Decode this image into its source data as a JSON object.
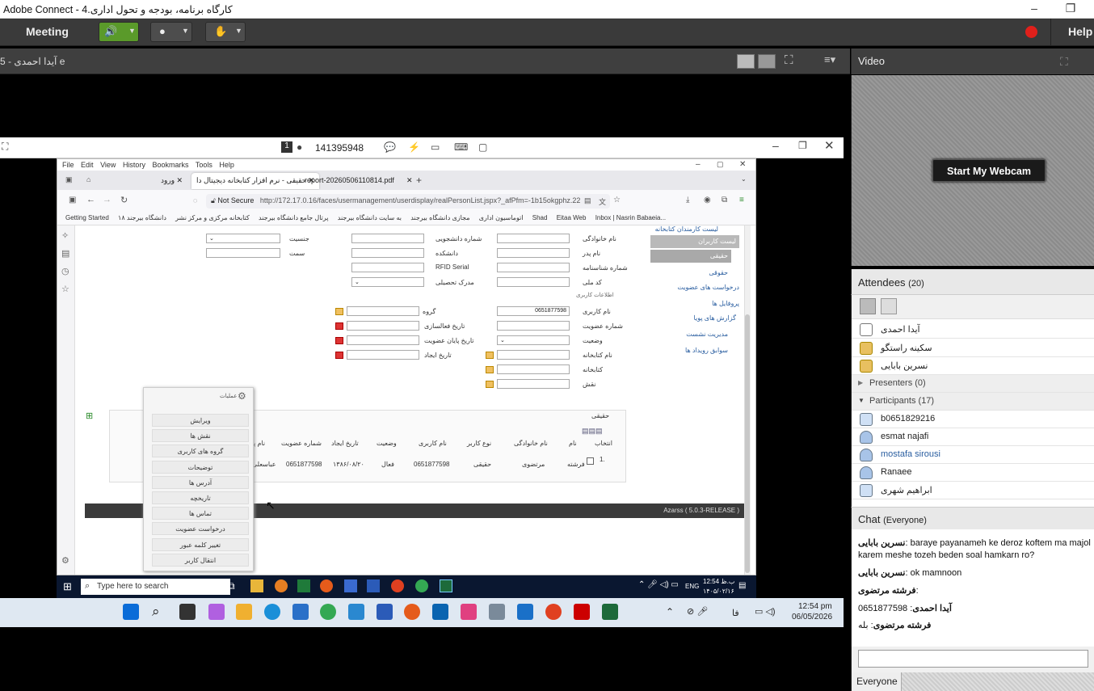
{
  "window": {
    "title": "Adobe Connect - کارگاه برنامه، بودجه و تحول اداری.4",
    "minimize": "–",
    "restore": "❐"
  },
  "menubar": {
    "meeting": "Meeting",
    "help": "Help"
  },
  "share": {
    "presenter_label": "آیدا احمدی - 5 e"
  },
  "rvw": {
    "page_num": "1",
    "meeting_id": "141395948"
  },
  "browser": {
    "menu": [
      "File",
      "Edit",
      "View",
      "History",
      "Bookmarks",
      "Tools",
      "Help"
    ],
    "tabs": [
      "ورود",
      "حقیقی - نرم افزار کتابخانه دیجیتال دا",
      "report-20260506110814.pdf"
    ],
    "new_tab": "+",
    "not_secure": "Not Secure",
    "url": "http://172.17.0.16/faces/usermanagement/userdisplay/realPersonList.jspx?_afPfm=-1b15okgphz.22",
    "bookmarks": [
      "Getting Started",
      "اتوماسیون اداری",
      "مجازی دانشگاه بیرجند",
      "به سایت دانشگاه بیرجند",
      "پرتال جامع دانشگاه بیرجند",
      "کتابخانه مرکزی و مرکز نشر",
      "دانشگاه بیرجند ۱۸",
      "Shad",
      "Eitaa Web",
      "Inbox | Nasrin Babaeia..."
    ]
  },
  "form": {
    "labels": {
      "family": "نام خانوادگی",
      "student_no": "شماره دانشجویی",
      "gender": "جنسیت",
      "father": "نام پدر",
      "faculty": "دانشکده",
      "post": "سمت",
      "id_no": "شماره شناسنامه",
      "rfid": "RFID Serial",
      "national": "کد ملی",
      "degree": "مدرک تحصیلی",
      "user_info": "اطلاعات کاربری",
      "username": "نام کاربری",
      "group": "گروه",
      "member_no": "شماره عضویت",
      "activation": "تاریخ فعالسازی",
      "status": "وضعیت",
      "end_date": "تاریخ پایان عضویت",
      "library": "نام کتابخانه",
      "created": "تاریخ ایجاد",
      "library2": "کتابخانه",
      "role": "نقش"
    },
    "username_value": "0651877598"
  },
  "nav": {
    "items": [
      "لیست کاربران",
      "حقیقی",
      "حقوقی",
      "درخواست های عضویت",
      "پروفایل ها",
      "گزارش های پویا",
      "مدیریت نشست",
      "سوابق رویداد ها"
    ],
    "top": "لیست کارمندان کتابخانه"
  },
  "results": {
    "title": "حقیقی",
    "headers": [
      "انتخاب",
      "نام",
      "نام خانوادگی",
      "نوع کاربر",
      "نام کاربری",
      "وضعیت",
      "تاریخ ایجاد",
      "شماره عضویت",
      "نام پدر",
      "ش"
    ],
    "row": {
      "index": "1.",
      "name": "فرشته",
      "family": "مرتضوی",
      "type": "حقیقی",
      "username": "0651877598",
      "status": "فعال",
      "created": "۱۳۸۶/۰۸/۲۰",
      "member_no": "0651877598",
      "father": "عباسعلی"
    }
  },
  "context_menu": {
    "title": "عملیات",
    "items": [
      "ویرایش",
      "نقش ها",
      "گروه های کاربری",
      "توضیحات",
      "آدرس ها",
      "تاریخچه",
      "تماس ها",
      "درخواست عضویت",
      "تغییر کلمه عبور",
      "انتقال کاربر"
    ]
  },
  "footer": {
    "text": "Azarss ( 5.0.3-RELEASE )"
  },
  "inner_taskbar": {
    "search": "Type here to search",
    "lang": "ENG",
    "time": "12:54 ب.ظ",
    "date": "۱۴۰۵/۰۲/۱۶"
  },
  "outer_taskbar": {
    "time": "12:54 pm",
    "date": "06/05/2026",
    "lang": "فا"
  },
  "video": {
    "title": "Video",
    "webcam_button": "Start My Webcam"
  },
  "attendees": {
    "title": "Attendees",
    "count": "(20)",
    "hosts": [
      "آیدا احمدی",
      "سکینه راستگو",
      "نسرین بابایی"
    ],
    "presenters": "Presenters (0)",
    "participants": "Participants (17)",
    "participant_list": [
      "b0651829216",
      "esmat najafi",
      "mostafa sirousi",
      "Ranaee",
      "ابراهیم شهری"
    ]
  },
  "chat": {
    "title": "Chat",
    "scope": "(Everyone)",
    "messages": [
      {
        "from": "نسرین بابایی",
        "text": ": baraye payanameh ke deroz koftem ma majol karem meshe tozeh beden soal hamkarn ro?"
      },
      {
        "from": "نسرین بابایی",
        "text": ": ok mamnoon"
      },
      {
        "from": "فرشته مرتضوی",
        "text": ":"
      },
      {
        "from": "آیدا احمدی",
        "text": ": 0651877598"
      },
      {
        "from": "فرشته مرتضوی",
        "text": ": بله"
      }
    ],
    "footer_scope": "Everyone"
  },
  "colors": {
    "record": "#e0201b",
    "accent": "#2a5ea0",
    "speaker": "#6bbf3a"
  }
}
